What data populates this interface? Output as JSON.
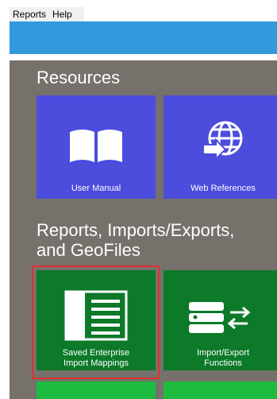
{
  "menu": {
    "items": [
      "Reports",
      "Help"
    ]
  },
  "sections": {
    "resources": {
      "title": "Resources"
    },
    "reports": {
      "title_line1": "Reports, Imports/Exports,",
      "title_line2": "and GeoFiles"
    }
  },
  "tiles": {
    "user_manual": {
      "label": "User Manual",
      "color": "#4c4cdd",
      "icon": "book-icon"
    },
    "web_references": {
      "label": "Web References",
      "color": "#4c4cdd",
      "icon": "globe-arrow-icon"
    },
    "saved_mappings": {
      "label_line1": "Saved Enterprise",
      "label_line2": "Import Mappings",
      "color": "#0d7a2a",
      "icon": "list-document-icon",
      "selected": true
    },
    "import_export": {
      "label_line1": "Import/Export",
      "label_line2": "Functions",
      "color": "#0d7a2a",
      "icon": "database-transfer-icon"
    }
  },
  "colors": {
    "panel": "#77716c",
    "header_blue": "#3399dd",
    "selection": "#e03131",
    "green_light": "#1dbb3f"
  }
}
